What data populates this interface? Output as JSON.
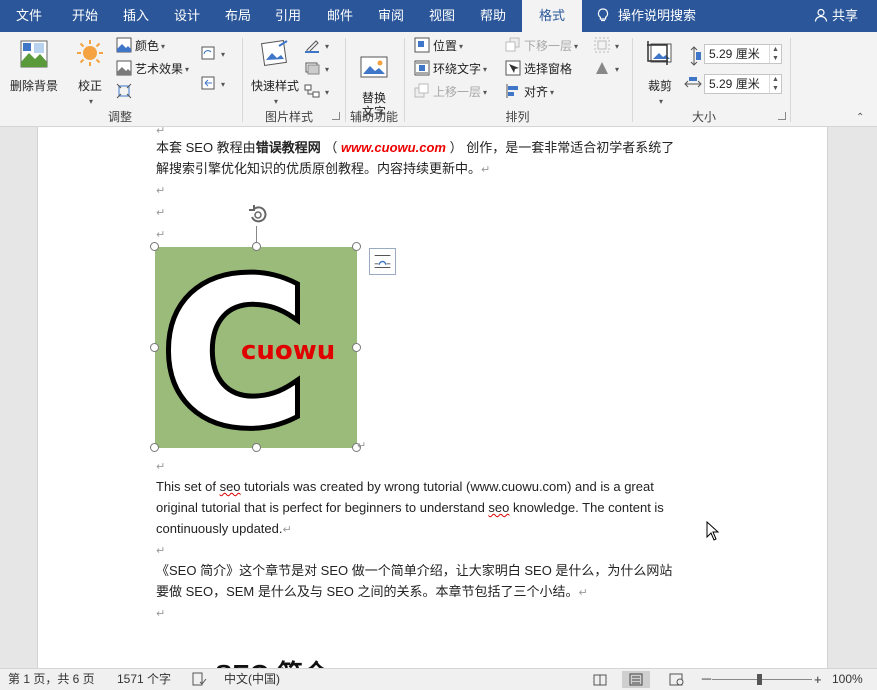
{
  "tabs": [
    "文件",
    "开始",
    "插入",
    "设计",
    "布局",
    "引用",
    "邮件",
    "审阅",
    "视图",
    "帮助",
    "格式"
  ],
  "active_tab": "格式",
  "tell_me": "操作说明搜索",
  "share": "共享",
  "ribbon": {
    "adjust": {
      "remove_bg": "删除背景",
      "correct": "校正",
      "color": "颜色",
      "art_effects": "艺术效果",
      "label": "调整"
    },
    "picture_styles": {
      "quick_styles": "快速样式",
      "label": "图片样式"
    },
    "accessibility": {
      "alt_text": "替换\n文字",
      "label": "辅助功能"
    },
    "arrange": {
      "position": "位置",
      "wrap_text": "环绕文字",
      "bring_forward": "上移一层",
      "send_backward": "下移一层",
      "selection_pane": "选择窗格",
      "align": "对齐",
      "label": "排列"
    },
    "size": {
      "crop": "裁剪",
      "height": "5.29 厘米",
      "width": "5.29 厘米",
      "label": "大小"
    }
  },
  "document": {
    "p1_line1_a": "本套 SEO 教程由",
    "p1_bold": "错误教程网",
    "p1_paren_open": "（",
    "p1_url": "www.cuowu.com",
    "p1_paren_close": "）",
    "p1_line1_b": "创作，是一套非常适合初学者系统了",
    "p1_line2": "解搜索引擎优化知识的优质原创教程。内容持续更新中。",
    "para_mark": "↵",
    "image_text": "cuowu",
    "image_letter": "C",
    "en_line1_a": "This set of ",
    "en_seo1": "seo",
    "en_line1_b": " tutorials was created by wrong tutorial (www.cuowu.com) and is a great",
    "en_line2_a": "original tutorial that is perfect for beginners to understand ",
    "en_seo2": "seo",
    "en_line2_b": " knowledge. The content is",
    "en_line3": "continuously updated.",
    "p3_line1": "《SEO 简介》这个章节是对 SEO 做一个简单介绍，让大家明白 SEO 是什么，为什么网站",
    "p3_line2": "要做 SEO，SEM 是什么及与 SEO 之间的关系。本章节包括了三个小结。",
    "heading": "SEO 简介"
  },
  "status": {
    "page": "第 1 页，共 6 页",
    "words": "1571 个字",
    "language": "中文(中国)",
    "zoom_minus": "－",
    "zoom_plus": "+",
    "zoom": "100%"
  },
  "colors": {
    "tabbar": "#2b579a",
    "image_bg": "#9bbb7b",
    "image_text": "#e00000",
    "url_red": "#e00000"
  }
}
